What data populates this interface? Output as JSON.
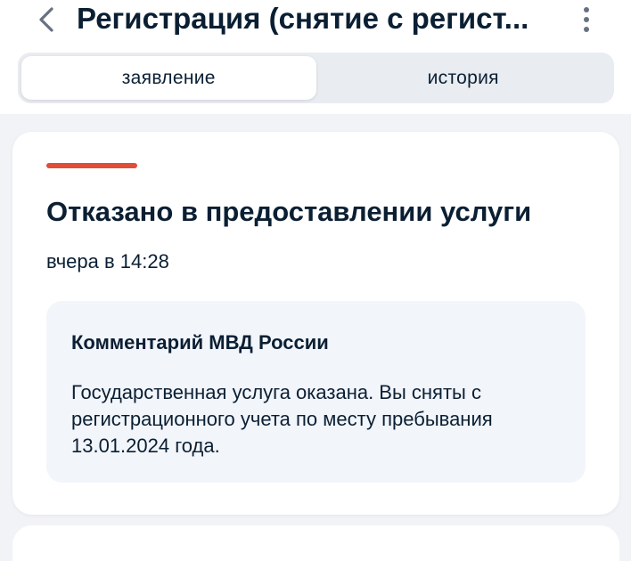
{
  "header": {
    "title": "Регистрация (снятие с регист...",
    "back_icon": "chevron-left-icon",
    "more_icon": "more-vertical-icon"
  },
  "tabs": [
    {
      "label": "заявление",
      "active": true
    },
    {
      "label": "история",
      "active": false
    }
  ],
  "status": {
    "title": "Отказано в предоставлении услуги",
    "time": "вчера в 14:28",
    "color": "#e04e39"
  },
  "comment": {
    "title": "Комментарий МВД России",
    "text": "Государственная услуга оказана. Вы сняты с регистрационного учета по месту пребывания 13.01.2024 года."
  }
}
